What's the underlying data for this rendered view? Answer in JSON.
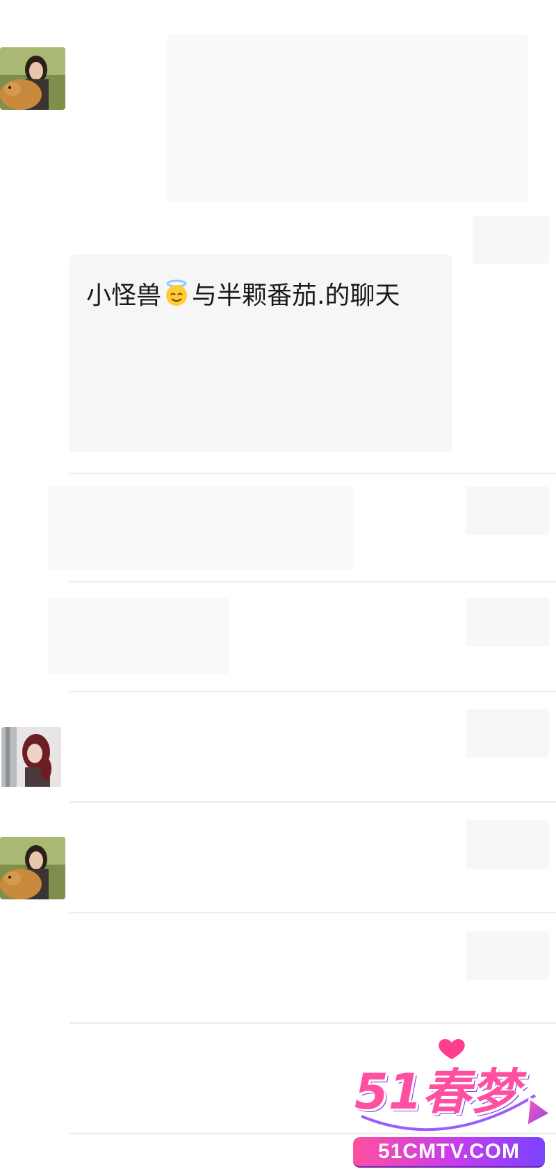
{
  "forwarded_chat": {
    "title_part1": "小怪兽",
    "emoji": "smiling-face-with-halo-emoji",
    "title_part2": "与半颗番茄.的聊天"
  },
  "watermark": {
    "logo_text": "51春梦",
    "domain": "51CMTV.COM"
  },
  "colors": {
    "card_bg": "#f6f6f7",
    "divider": "#ececec",
    "watermark_pink": "#ff4fa0",
    "watermark_purple": "#7a43ff"
  }
}
